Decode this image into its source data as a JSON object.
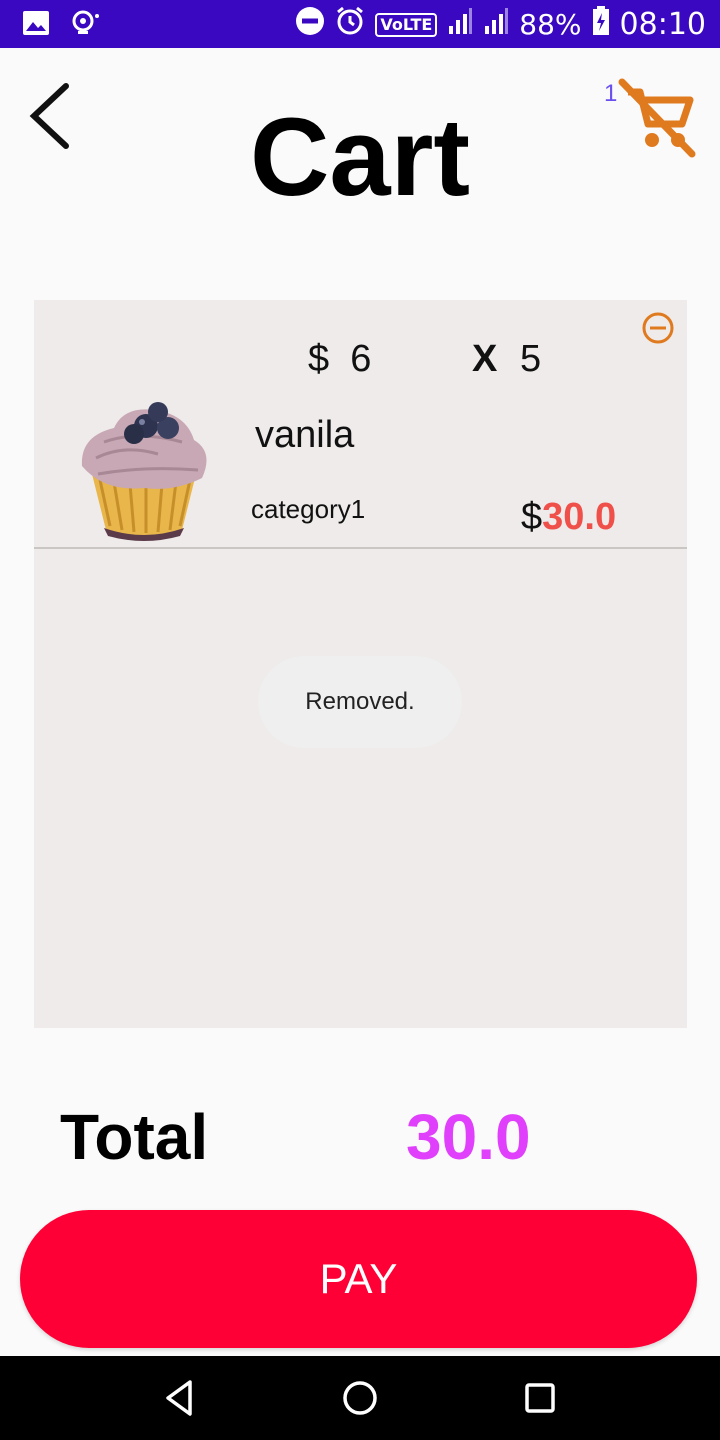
{
  "status_bar": {
    "volte": "VoLTE",
    "battery": "88%",
    "time": "08:10"
  },
  "header": {
    "title": "Cart",
    "cart_count": "1"
  },
  "cart": {
    "items": [
      {
        "currency": "$",
        "unit_price": "6",
        "qty_symbol": "X",
        "quantity": "5",
        "name": "vanila",
        "category": "category1",
        "total_currency": "$",
        "total": "30.0"
      }
    ]
  },
  "toast": {
    "message": "Removed."
  },
  "summary": {
    "total_label": "Total",
    "total_value": "30.0"
  },
  "actions": {
    "pay_label": "PAY"
  },
  "colors": {
    "status_bar": "#3a08c0",
    "cart_icon": "#e07a1f",
    "price_accent": "#f0504a",
    "total_value": "#e040fb",
    "pay_button": "#ff0036"
  },
  "icons": {
    "back": "back-arrow-icon",
    "cart": "remove-shopping-cart-icon",
    "remove_item": "remove-circle-icon",
    "nav_back": "nav-back-icon",
    "nav_home": "nav-home-icon",
    "nav_recents": "nav-recents-icon"
  }
}
